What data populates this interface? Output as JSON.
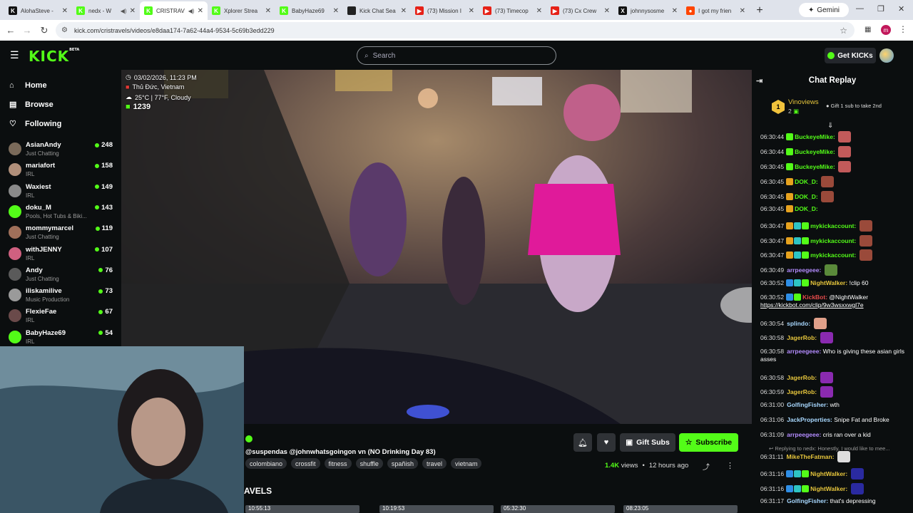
{
  "browser": {
    "tabs": [
      {
        "title": "AlohaSteve -",
        "fav_color": "#111",
        "fav_text": "K",
        "active": false
      },
      {
        "title": "nedx - W",
        "fav_color": "#53fc18",
        "fav_text": "K",
        "active": false,
        "audio": true
      },
      {
        "title": "CRISTRAV",
        "fav_color": "#53fc18",
        "fav_text": "K",
        "active": true,
        "audio": true
      },
      {
        "title": "Xplorer Strea",
        "fav_color": "#53fc18",
        "fav_text": "K",
        "active": false
      },
      {
        "title": "BabyHaze69",
        "fav_color": "#53fc18",
        "fav_text": "K",
        "active": false
      },
      {
        "title": "Kick Chat Sea",
        "fav_color": "#222",
        "fav_text": "",
        "active": false
      },
      {
        "title": "(73) Mission I",
        "fav_color": "#e62117",
        "fav_text": "▶",
        "active": false
      },
      {
        "title": "(73) Timecop",
        "fav_color": "#e62117",
        "fav_text": "▶",
        "active": false
      },
      {
        "title": "(73) Cx Crew",
        "fav_color": "#e62117",
        "fav_text": "▶",
        "active": false
      },
      {
        "title": "johnnysosme",
        "fav_color": "#111",
        "fav_text": "X",
        "active": false
      },
      {
        "title": "I got my frien",
        "fav_color": "#ff4500",
        "fav_text": "●",
        "active": false
      }
    ],
    "gemini_label": "Gemini",
    "url": "kick.com/cristravels/videos/e8daa174-7a62-44a4-9534-5c69b3edd229",
    "profile_initial": "m"
  },
  "header": {
    "logo": "KICK",
    "logo_beta": "BETA",
    "search_placeholder": "Search",
    "get_kicks": "Get KICKs"
  },
  "sidebar": {
    "nav": [
      {
        "icon": "⌂",
        "label": "Home"
      },
      {
        "icon": "▤",
        "label": "Browse"
      },
      {
        "icon": "♡",
        "label": "Following"
      }
    ],
    "channels": [
      {
        "name": "AsianAndy",
        "category": "Just Chatting",
        "viewers": "248",
        "color": "#7a6a5a"
      },
      {
        "name": "mariafort",
        "category": "IRL",
        "viewers": "158",
        "color": "#b08f7a"
      },
      {
        "name": "Waxiest",
        "category": "IRL",
        "viewers": "149",
        "color": "#8a8a8a"
      },
      {
        "name": "doku_M",
        "category": "Pools, Hot Tubs & Biki...",
        "viewers": "143",
        "color": "#53fc18"
      },
      {
        "name": "mommymarcel",
        "category": "Just Chatting",
        "viewers": "119",
        "color": "#a0705a"
      },
      {
        "name": "withJENNY",
        "category": "IRL",
        "viewers": "107",
        "color": "#d06080"
      },
      {
        "name": "Andy",
        "category": "Just Chatting",
        "viewers": "76",
        "color": "#5a5a5a"
      },
      {
        "name": "iliskamilive",
        "category": "Music Production",
        "viewers": "73",
        "color": "#9a9a9a"
      },
      {
        "name": "FlexieFae",
        "category": "IRL",
        "viewers": "67",
        "color": "#6a4a4a"
      },
      {
        "name": "BabyHaze69",
        "category": "IRL",
        "viewers": "54",
        "color": "#53fc18"
      }
    ]
  },
  "video": {
    "overlay_datetime": "03/02/2026, 11:23 PM",
    "overlay_location": "Thủ Đức, Vietnam",
    "overlay_weather": "25°C | 77°F, Cloudy",
    "overlay_viewers": "1239"
  },
  "info": {
    "title": "@suspendas @johnwhatsgoingon vn (NO Drinking Day 83)",
    "tags": [
      "colombiano",
      "crossfit",
      "fitness",
      "shuffle",
      "spañish",
      "travel",
      "vietnam"
    ],
    "gift_subs": "Gift Subs",
    "subscribe": "Subscribe",
    "views_count": "1.4K",
    "views_label": "views",
    "age": "12 hours ago",
    "section_title": "AVELS",
    "thumbs": [
      "10:55:13",
      "10:19:53",
      "05:32:30",
      "08:23:05"
    ]
  },
  "chat": {
    "title": "Chat Replay",
    "pinned_name": "Vinoviews",
    "pinned_count": "2",
    "pinned_rank": "1",
    "gift_text": "Gift 1 sub to take 2nd",
    "messages": [
      {
        "ts": "06:30:44",
        "user": "BuckeyeMike:",
        "color": "#53fc18",
        "badges": [
          "#53fc18"
        ],
        "text": "",
        "emote": "#c25a5a"
      },
      {
        "ts": "06:30:44",
        "user": "BuckeyeMike:",
        "color": "#53fc18",
        "badges": [
          "#53fc18"
        ],
        "text": "",
        "emote": "#c25a5a"
      },
      {
        "ts": "06:30:45",
        "user": "BuckeyeMike:",
        "color": "#53fc18",
        "badges": [
          "#53fc18"
        ],
        "text": "",
        "emote": "#c25a5a"
      },
      {
        "ts": "06:30:45",
        "user": "DOK_D:",
        "color": "#53fc18",
        "badges": [
          "#e6a21e"
        ],
        "text": "",
        "emote": "#9a4a3a"
      },
      {
        "ts": "06:30:45",
        "user": "DOK_D:",
        "color": "#53fc18",
        "badges": [
          "#e6a21e"
        ],
        "text": "",
        "emote": "#9a4a3a"
      },
      {
        "ts": "06:30:45",
        "user": "DOK_D:",
        "color": "#53fc18",
        "badges": [
          "#e6a21e"
        ],
        "text": "",
        "emote": ""
      },
      {
        "ts": "06:30:47",
        "user": "mykickaccount:",
        "color": "#53fc18",
        "badges": [
          "#e6a21e",
          "#2ec4c4",
          "#53fc18"
        ],
        "text": "",
        "emote": "#9a4a3a"
      },
      {
        "ts": "06:30:47",
        "user": "mykickaccount:",
        "color": "#53fc18",
        "badges": [
          "#e6a21e",
          "#2ec4c4",
          "#53fc18"
        ],
        "text": "",
        "emote": "#9a4a3a"
      },
      {
        "ts": "06:30:47",
        "user": "mykickaccount:",
        "color": "#53fc18",
        "badges": [
          "#e6a21e",
          "#2ec4c4",
          "#53fc18"
        ],
        "text": "",
        "emote": "#9a4a3a"
      },
      {
        "ts": "06:30:49",
        "user": "arrpeegeee:",
        "color": "#b48cff",
        "badges": [],
        "text": "",
        "emote": "#5a8a3a"
      },
      {
        "ts": "06:30:52",
        "user": "NightWalker:",
        "color": "#e6c53c",
        "badges": [
          "#2e8ee6",
          "#2ec4c4",
          "#53fc18"
        ],
        "text": "!clip 60",
        "emote": ""
      },
      {
        "ts": "06:30:52",
        "user": "KickBot:",
        "color": "#e64b4b",
        "badges": [
          "#2e8ee6",
          "#53fc18"
        ],
        "text": "@NightWalker",
        "emote": ""
      },
      {
        "ts": "06:30:54",
        "user": "splindo:",
        "color": "#a8d8ff",
        "badges": [],
        "text": "",
        "emote": "#e0a08a"
      },
      {
        "ts": "06:30:58",
        "user": "JagerRob:",
        "color": "#e6c53c",
        "badges": [],
        "text": "",
        "emote": "#8a2ab0"
      },
      {
        "ts": "06:30:58",
        "user": "arrpeegeee:",
        "color": "#b48cff",
        "badges": [],
        "text": "Who is giving these asian girls asses",
        "emote": ""
      },
      {
        "ts": "06:30:58",
        "user": "JagerRob:",
        "color": "#e6c53c",
        "badges": [],
        "text": "",
        "emote": "#8a2ab0"
      },
      {
        "ts": "06:30:59",
        "user": "JagerRob:",
        "color": "#e6c53c",
        "badges": [],
        "text": "",
        "emote": "#8a2ab0"
      },
      {
        "ts": "06:31:00",
        "user": "GolfingFisher:",
        "color": "#a8d8ff",
        "badges": [],
        "text": "wth",
        "emote": ""
      },
      {
        "ts": "06:31:06",
        "user": "JackProperties:",
        "color": "#a8d8ff",
        "badges": [],
        "text": "Snipe Fat and Broke",
        "emote": ""
      },
      {
        "ts": "06:31:09",
        "user": "arrpeegeee:",
        "color": "#b48cff",
        "badges": [],
        "text": "cris ran over a kid",
        "emote": ""
      },
      {
        "ts": "06:31:11",
        "user": "MikeTheFatman:",
        "color": "#e6c53c",
        "badges": [],
        "text": "",
        "emote": "#ddd"
      },
      {
        "ts": "06:31:16",
        "user": "NightWalker:",
        "color": "#e6c53c",
        "badges": [
          "#2e8ee6",
          "#2ec4c4",
          "#53fc18"
        ],
        "text": "",
        "emote": "#2a2aa0"
      },
      {
        "ts": "06:31:16",
        "user": "NightWalker:",
        "color": "#e6c53c",
        "badges": [
          "#2e8ee6",
          "#2ec4c4",
          "#53fc18"
        ],
        "text": "",
        "emote": "#2a2aa0"
      },
      {
        "ts": "06:31:17",
        "user": "GolfingFisher:",
        "color": "#a8d8ff",
        "badges": [],
        "text": "that's depressing",
        "emote": ""
      }
    ],
    "kickbot_link": "https://kickbot.com/clip/9w3wsxxwgl7e",
    "reply_hint": "Replying to nedx: Honestly, I would like to mee..."
  }
}
